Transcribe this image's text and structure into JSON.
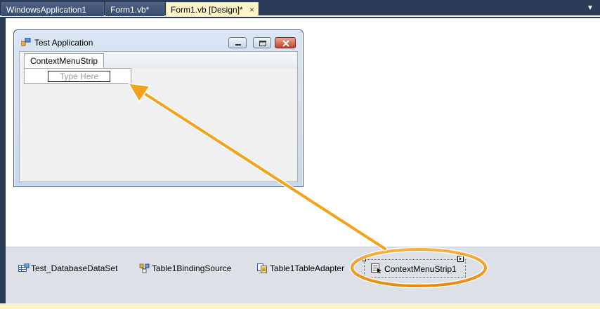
{
  "tabs": [
    {
      "label": "WindowsApplication1",
      "active": false
    },
    {
      "label": "Form1.vb*",
      "active": false
    },
    {
      "label": "Form1.vb [Design]*",
      "active": true
    }
  ],
  "tab_close_glyph": "×",
  "tab_overflow_glyph": "▼",
  "form": {
    "title": "Test Application",
    "menu_tab_label": "ContextMenuStrip",
    "type_here_placeholder": "Type Here"
  },
  "tray": {
    "items": [
      {
        "label": "Test_DatabaseDataSet",
        "icon": "dataset-icon"
      },
      {
        "label": "Table1BindingSource",
        "icon": "binding-source-icon"
      },
      {
        "label": "Table1TableAdapter",
        "icon": "table-adapter-icon"
      },
      {
        "label": "ContextMenuStrip1",
        "icon": "context-menu-strip-icon",
        "selected": true
      }
    ]
  },
  "colors": {
    "annotation": "#f6a01a",
    "chrome": "#2b3c59",
    "active_tab": "#fff3c8"
  }
}
